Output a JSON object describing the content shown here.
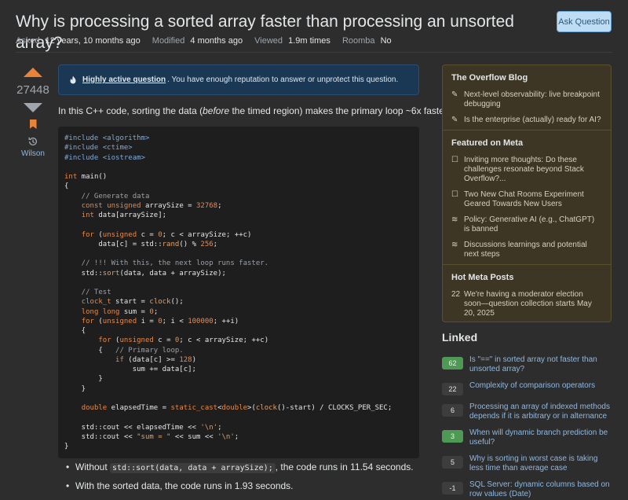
{
  "question": {
    "title": "Why is processing a sorted array faster than processing an unsorted array?",
    "ask_button": "Ask Question",
    "meta": [
      {
        "label": "Asked",
        "value": "12 years, 10 months ago"
      },
      {
        "label": "Modified",
        "value": "4 months ago"
      },
      {
        "label": "Viewed",
        "value": "1.9m times"
      },
      {
        "label": "Roomba",
        "value": "No"
      }
    ],
    "votes": "27448",
    "author": "Wilson",
    "notice_link": "Highly active question",
    "notice_text": ". You have enough reputation to answer or unprotect this question.",
    "intro_pre": "In this C++ code, sorting the data (",
    "intro_em": "before",
    "intro_post": " the timed region) makes the primary loop ~6x faster:",
    "bullets": [
      {
        "pre": "Without ",
        "code": "std::sort(data, data + arraySize);",
        "post": ", the code runs in 11.54 seconds."
      },
      {
        "pre": "With the sorted data, the code runs in 1.93 seconds.",
        "code": "",
        "post": ""
      }
    ]
  },
  "code_lines": [
    [
      {
        "t": "#include <algorithm>",
        "c": "pp"
      }
    ],
    [
      {
        "t": "#include <ctime>",
        "c": "pp"
      }
    ],
    [
      {
        "t": "#include <iostream>",
        "c": "pp"
      }
    ],
    [],
    [
      {
        "t": "int",
        "c": "kw"
      },
      {
        "t": " main()",
        "c": ""
      }
    ],
    [
      {
        "t": "{",
        "c": ""
      }
    ],
    [
      {
        "t": "    // Generate data",
        "c": "cm"
      }
    ],
    [
      {
        "t": "    ",
        "c": ""
      },
      {
        "t": "const unsigned",
        "c": "kw"
      },
      {
        "t": " arraySize = ",
        "c": ""
      },
      {
        "t": "32768",
        "c": "num"
      },
      {
        "t": ";",
        "c": ""
      }
    ],
    [
      {
        "t": "    ",
        "c": ""
      },
      {
        "t": "int",
        "c": "kw"
      },
      {
        "t": " data[arraySize];",
        "c": ""
      }
    ],
    [],
    [
      {
        "t": "    ",
        "c": ""
      },
      {
        "t": "for",
        "c": "kw"
      },
      {
        "t": " (",
        "c": ""
      },
      {
        "t": "unsigned",
        "c": "kw"
      },
      {
        "t": " c = ",
        "c": ""
      },
      {
        "t": "0",
        "c": "num"
      },
      {
        "t": "; c < arraySize; ++c)",
        "c": ""
      }
    ],
    [
      {
        "t": "        data[c] = std::",
        "c": ""
      },
      {
        "t": "rand",
        "c": "fn"
      },
      {
        "t": "() % ",
        "c": ""
      },
      {
        "t": "256",
        "c": "num"
      },
      {
        "t": ";",
        "c": ""
      }
    ],
    [],
    [
      {
        "t": "    // !!! With this, the next loop runs faster.",
        "c": "cm"
      }
    ],
    [
      {
        "t": "    std::",
        "c": ""
      },
      {
        "t": "sort",
        "c": "fn"
      },
      {
        "t": "(data, data + arraySize);",
        "c": ""
      }
    ],
    [],
    [
      {
        "t": "    // Test",
        "c": "cm"
      }
    ],
    [
      {
        "t": "    ",
        "c": ""
      },
      {
        "t": "clock_t",
        "c": "kw"
      },
      {
        "t": " start = ",
        "c": ""
      },
      {
        "t": "clock",
        "c": "fn"
      },
      {
        "t": "();",
        "c": ""
      }
    ],
    [
      {
        "t": "    ",
        "c": ""
      },
      {
        "t": "long long",
        "c": "kw"
      },
      {
        "t": " sum = ",
        "c": ""
      },
      {
        "t": "0",
        "c": "num"
      },
      {
        "t": ";",
        "c": ""
      }
    ],
    [
      {
        "t": "    ",
        "c": ""
      },
      {
        "t": "for",
        "c": "kw"
      },
      {
        "t": " (",
        "c": ""
      },
      {
        "t": "unsigned",
        "c": "kw"
      },
      {
        "t": " i = ",
        "c": ""
      },
      {
        "t": "0",
        "c": "num"
      },
      {
        "t": "; i < ",
        "c": ""
      },
      {
        "t": "100000",
        "c": "num"
      },
      {
        "t": "; ++i)",
        "c": ""
      }
    ],
    [
      {
        "t": "    {",
        "c": ""
      }
    ],
    [
      {
        "t": "        ",
        "c": ""
      },
      {
        "t": "for",
        "c": "kw"
      },
      {
        "t": " (",
        "c": ""
      },
      {
        "t": "unsigned",
        "c": "kw"
      },
      {
        "t": " c = ",
        "c": ""
      },
      {
        "t": "0",
        "c": "num"
      },
      {
        "t": "; c < arraySize; ++c)",
        "c": ""
      }
    ],
    [
      {
        "t": "        {   ",
        "c": ""
      },
      {
        "t": "// Primary loop.",
        "c": "cm"
      }
    ],
    [
      {
        "t": "            ",
        "c": ""
      },
      {
        "t": "if",
        "c": "kw"
      },
      {
        "t": " (data[c] >= ",
        "c": ""
      },
      {
        "t": "128",
        "c": "num"
      },
      {
        "t": ")",
        "c": ""
      }
    ],
    [
      {
        "t": "                sum += data[c];",
        "c": ""
      }
    ],
    [
      {
        "t": "        }",
        "c": ""
      }
    ],
    [
      {
        "t": "    }",
        "c": ""
      }
    ],
    [],
    [
      {
        "t": "    ",
        "c": ""
      },
      {
        "t": "double",
        "c": "kw"
      },
      {
        "t": " elapsedTime = ",
        "c": ""
      },
      {
        "t": "static_cast",
        "c": "kw"
      },
      {
        "t": "<",
        "c": ""
      },
      {
        "t": "double",
        "c": "kw"
      },
      {
        "t": ">(",
        "c": ""
      },
      {
        "t": "clock",
        "c": "fn"
      },
      {
        "t": "()-start) / CLOCKS_PER_SEC;",
        "c": ""
      }
    ],
    [],
    [
      {
        "t": "    std::cout << elapsedTime << ",
        "c": ""
      },
      {
        "t": "'\\n'",
        "c": "str"
      },
      {
        "t": ";",
        "c": ""
      }
    ],
    [
      {
        "t": "    std::cout << ",
        "c": ""
      },
      {
        "t": "\"sum = \"",
        "c": "str"
      },
      {
        "t": " << sum << ",
        "c": ""
      },
      {
        "t": "'\\n'",
        "c": "str"
      },
      {
        "t": ";",
        "c": ""
      }
    ],
    [
      {
        "t": "}",
        "c": ""
      }
    ]
  ],
  "sidebar": {
    "blog_title": "The Overflow Blog",
    "blog_items": [
      {
        "icon": "pencil-icon",
        "text": "Next-level observability: live breakpoint debugging"
      },
      {
        "icon": "pencil-icon",
        "text": "Is the enterprise (actually) ready for AI?"
      }
    ],
    "meta_title": "Featured on Meta",
    "meta_items": [
      {
        "icon": "comment-icon",
        "text": "Inviting more thoughts: Do these challenges resonate beyond Stack Overflow?..."
      },
      {
        "icon": "comment-icon",
        "text": "Two New Chat Rooms Experiment Geared Towards New Users"
      },
      {
        "icon": "stack-icon",
        "text": "Policy: Generative AI (e.g., ChatGPT) is banned"
      },
      {
        "icon": "stack-icon",
        "text": "Discussions learnings and potential next steps"
      }
    ],
    "hot_title": "Hot Meta Posts",
    "hot_items": [
      {
        "count": "22",
        "text": "We're having a moderator election soon—question collection starts May 20, 2025"
      }
    ]
  },
  "linked": {
    "title": "Linked",
    "items": [
      {
        "count": "62",
        "accepted": true,
        "text": "Is \"==\" in sorted array not faster than unsorted array?"
      },
      {
        "count": "22",
        "accepted": false,
        "text": "Complexity of comparison operators"
      },
      {
        "count": "6",
        "accepted": false,
        "text": "Processing an array of indexed methods depends if it is arbitrary or in alternance"
      },
      {
        "count": "3",
        "accepted": true,
        "text": "When will dynamic branch prediction be useful?"
      },
      {
        "count": "5",
        "accepted": false,
        "text": "Why is sorting in worst case is taking less time than average case"
      },
      {
        "count": "-1",
        "accepted": false,
        "text": "SQL Server: dynamic columns based on row values (Date)"
      }
    ]
  },
  "colors": {
    "background": "#2d2d2d",
    "accent_orange": "#e8833a",
    "link_blue": "#8fb8e0",
    "accepted_green": "#4e9a55"
  }
}
